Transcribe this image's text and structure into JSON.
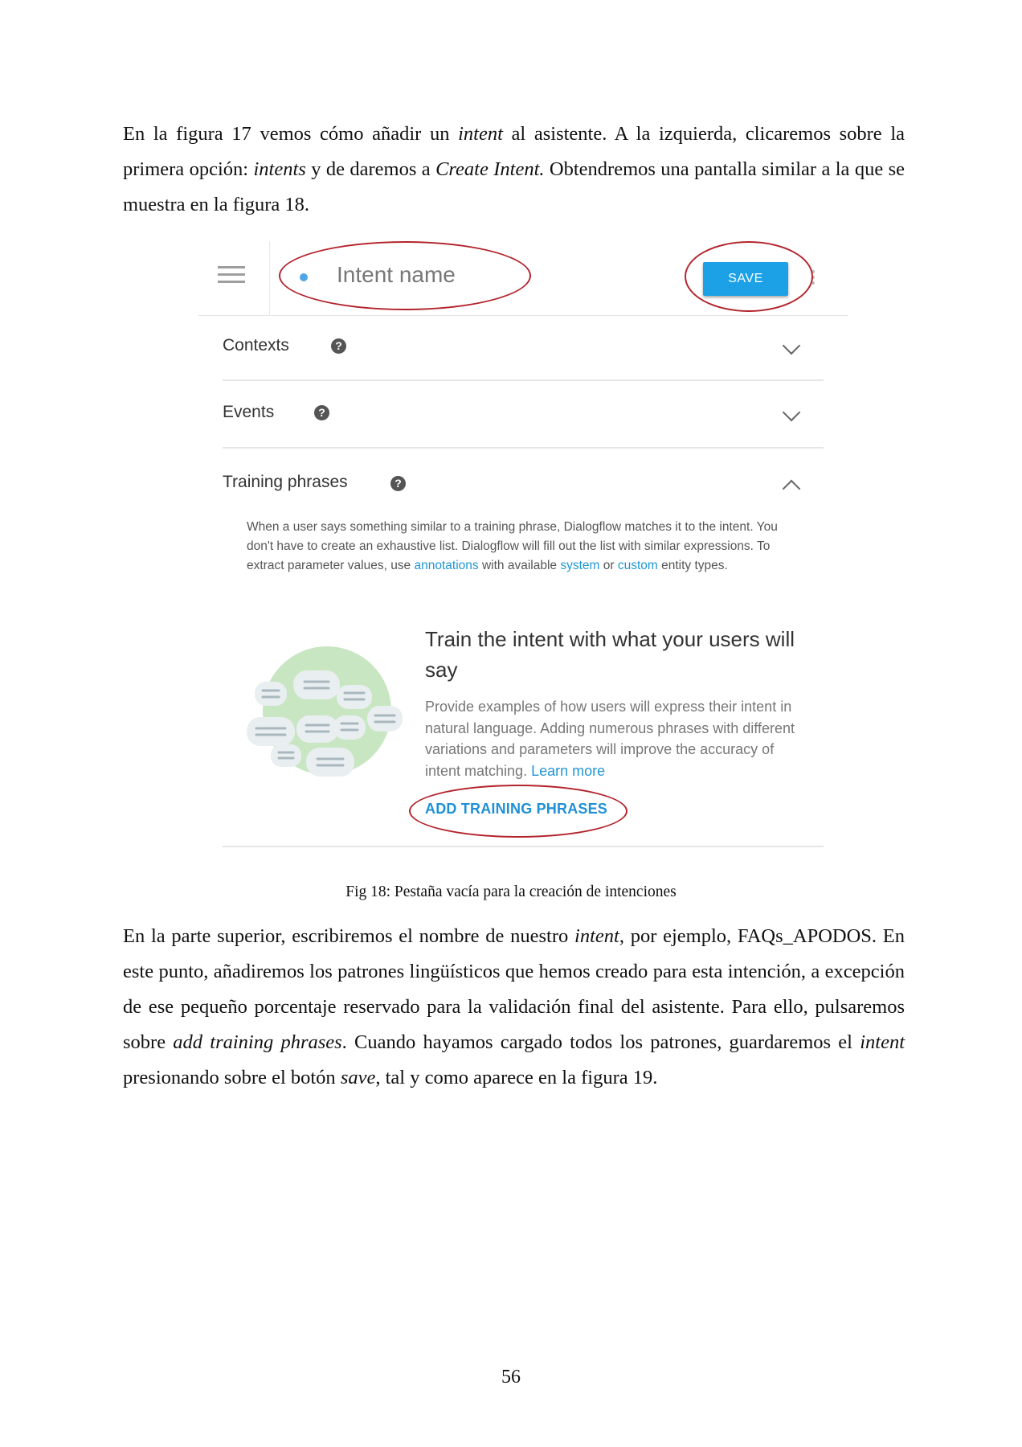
{
  "paragraph1": {
    "s1": "En la figura 17 vemos cómo añadir un ",
    "s1_em": "intent",
    "s2": " al asistente. A la izquierda, clicaremos sobre la primera opción: ",
    "s2_em": "intents",
    "s3": " y de daremos a ",
    "s3_em": "Create Intent.",
    "s4": " Obtendremos una pantalla similar a la que se muestra en la figura 18."
  },
  "figure": {
    "intent_name_placeholder": "Intent name",
    "save_label": "SAVE",
    "contexts_label": "Contexts",
    "events_label": "Events",
    "training_label": "Training phrases",
    "help_glyph": "?",
    "description": {
      "t1": "When a user says something similar to a training phrase, Dialogflow matches it to the intent. You don't have to create an exhaustive list. Dialogflow will fill out the list with similar expressions. To extract parameter values, use ",
      "link1": "annotations",
      "t2": " with available ",
      "link2": "system",
      "t3": " or ",
      "link3": "custom",
      "t4": " entity types."
    },
    "cta_title": "Train the intent with what your users will say",
    "cta_body": "Provide examples of how users will express their intent in natural language. Adding numerous phrases with different variations and parameters will improve the accuracy of intent matching. ",
    "learn_more": "Learn more",
    "add_training_label": "ADD TRAINING PHRASES",
    "colors": {
      "accent": "#1da1e6",
      "annotation_ring": "#b3242c",
      "link": "#2196d3"
    }
  },
  "caption": "Fig 18: Pestaña vacía para la creación de intenciones",
  "paragraph2": {
    "s1": "En la parte superior, escribiremos el nombre de nuestro ",
    "s1_em": "intent",
    "s2": ", por ejemplo, FAQs_APODOS. En este punto, añadiremos los patrones lingüísticos que hemos creado para esta intención, a excepción de ese pequeño porcentaje reservado para la validación final del asistente. Para ello, pulsaremos sobre ",
    "s2_em": "add training phrases",
    "s3": ". Cuando hayamos cargado todos los patrones, guardaremos el ",
    "s3_em": "intent",
    "s4": " presionando sobre el botón ",
    "s4_em": "save",
    "s5": ", tal y como aparece en la figura 19."
  },
  "page_number": "56"
}
